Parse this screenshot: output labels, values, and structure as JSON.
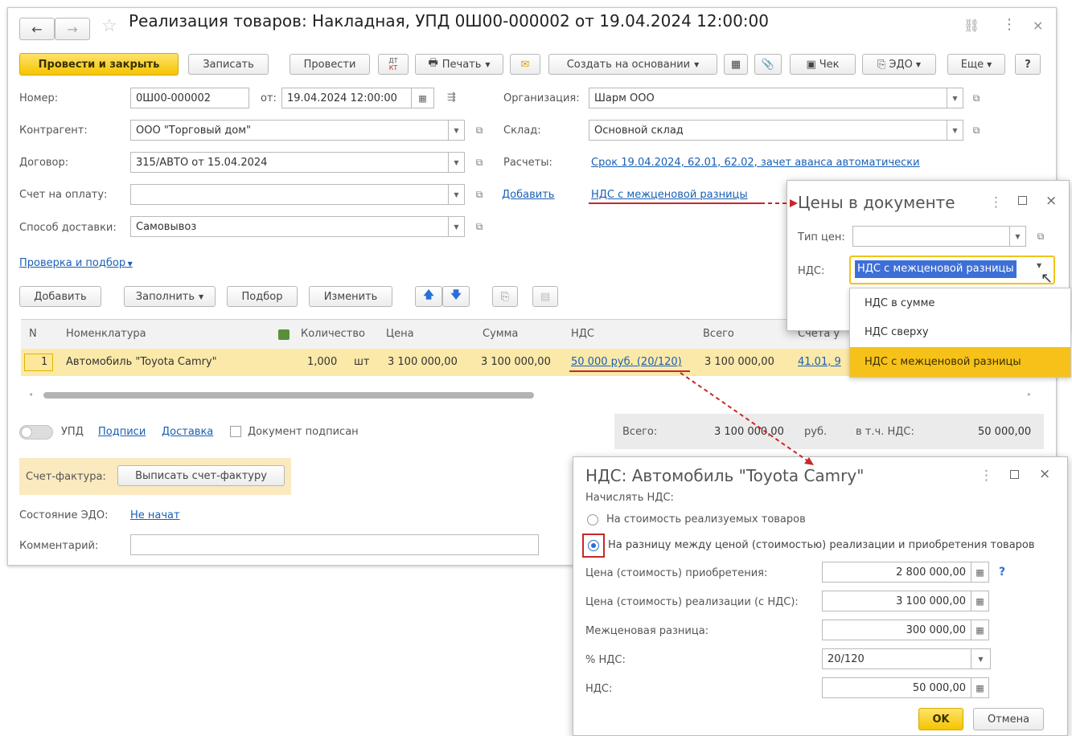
{
  "window": {
    "title": "Реализация товаров: Накладная, УПД 0Ш00-000002 от 19.04.2024 12:00:00",
    "more_icon": "⋮",
    "close_icon": "×"
  },
  "toolbar": {
    "post_close": "Провести и закрыть",
    "save": "Записать",
    "post": "Провести",
    "dtkt_top": "ДТ",
    "dtkt_bottom": "КТ",
    "print": "Печать",
    "create_based": "Создать на основании",
    "check": "Чек",
    "edo": "ЭДО",
    "more": "Еще",
    "help": "?"
  },
  "form": {
    "number_label": "Номер:",
    "number_value": "0Ш00-000002",
    "from_label": "от:",
    "date_value": "19.04.2024 12:00:00",
    "org_label": "Организация:",
    "org_value": "Шарм ООО",
    "counterparty_label": "Контрагент:",
    "counterparty_value": "ООО \"Торговый дом\"",
    "warehouse_label": "Склад:",
    "warehouse_value": "Основной склад",
    "contract_label": "Договор:",
    "contract_value": "315/АВТО от 15.04.2024",
    "settlements_label": "Расчеты:",
    "settlements_link": "Срок 19.04.2024, 62.01, 62.02, зачет аванса автоматически",
    "invoice_label": "Счет на оплату:",
    "invoice_value": "",
    "add_link": "Добавить",
    "vat_link": "НДС с межценовой разницы",
    "delivery_label": "Способ доставки:",
    "delivery_value": "Самовывоз",
    "check_pick_link": "Проверка и подбор"
  },
  "table_toolbar": {
    "add": "Добавить",
    "fill": "Заполнить",
    "pick": "Подбор",
    "change": "Изменить"
  },
  "table": {
    "columns": [
      "N",
      "Номенклатура",
      "Количество",
      "Цена",
      "Сумма",
      "НДС",
      "Всего",
      "Счета у"
    ],
    "rows": [
      {
        "n": "1",
        "item": "Автомобиль \"Toyota Camry\"",
        "qty": "1,000",
        "unit": "шт",
        "price": "3 100 000,00",
        "sum": "3 100 000,00",
        "vat": "50 000 руб. (20/120)",
        "total": "3 100 000,00",
        "accounts": "41.01, 9"
      }
    ]
  },
  "footer": {
    "upd_label": "УПД",
    "signatures_link": "Подписи",
    "delivery_link": "Доставка",
    "signed_label": "Документ подписан",
    "total_label": "Всего:",
    "total_value": "3 100 000,00",
    "currency": "руб.",
    "vat_incl_label": "в т.ч. НДС:",
    "vat_incl_value": "50 000,00",
    "invoice_label": "Счет-фактура:",
    "invoice_button": "Выписать счет-фактуру",
    "edo_state_label": "Состояние ЭДО:",
    "edo_state_link": "Не начат",
    "comment_label": "Комментарий:",
    "comment_value": ""
  },
  "prices_dialog": {
    "title": "Цены в документе",
    "price_type_label": "Тип цен:",
    "price_type_value": "",
    "vat_label": "НДС:",
    "vat_value": "НДС с межценовой разницы",
    "options": [
      "НДС в сумме",
      "НДС сверху",
      "НДС с межценовой разницы"
    ]
  },
  "vat_dialog": {
    "title": "НДС: Автомобиль \"Toyota Camry\"",
    "charge_label": "Начислять НДС:",
    "option_cost": "На стоимость реализуемых товаров",
    "option_diff": "На разницу между ценой (стоимостью) реализации и приобретения товаров",
    "purchase_label": "Цена (стоимость) приобретения:",
    "purchase_value": "2 800 000,00",
    "sale_label": "Цена (стоимость) реализации (с НДС):",
    "sale_value": "3 100 000,00",
    "diff_label": "Межценовая разница:",
    "diff_value": "300 000,00",
    "rate_label": "% НДС:",
    "rate_value": "20/120",
    "vat_label": "НДС:",
    "vat_value": "50 000,00",
    "ok": "OK",
    "cancel": "Отмена",
    "help": "?"
  },
  "colors": {
    "accent_yellow": "#f5c400",
    "link": "#1a5fb4",
    "row_highlight": "#fbe9a9",
    "annotation_red": "#c62828"
  }
}
